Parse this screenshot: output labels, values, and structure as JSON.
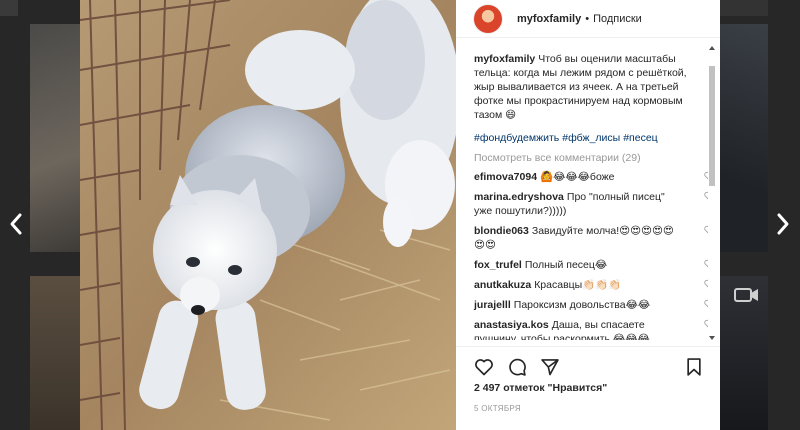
{
  "post": {
    "username": "myfoxfamily",
    "separator": "•",
    "follow_label": "Подписки",
    "caption_user": "myfoxfamily",
    "caption_text": "Чтоб вы оценили масштабы тельца: когда мы лежим рядом с решёткой, жыр вываливается из ячеек. А на третьей фотке мы прокрастинируем над кормовым тазом 😄",
    "hashtags": [
      "#фондбудемжить",
      "#фбж_лисы",
      "#песец"
    ],
    "view_all_comments": "Посмотреть все комментарии (29)",
    "likes": "2 497 отметок \"Нравится\"",
    "date": "5 октября"
  },
  "comments": [
    {
      "user": "efimova7094",
      "text": "🙆😂😂😂боже"
    },
    {
      "user": "marina.edryshova",
      "text": "Про \"полный писец\" уже пошутили?)))))"
    },
    {
      "user": "blondie063",
      "text": "Завидуйте молча!😍😍😍😍😍😍😍"
    },
    {
      "user": "fox_trufel",
      "text": "Полный песец😂"
    },
    {
      "user": "anutkakuza",
      "text": "Красавцы👏🏻👏🏻👏🏻"
    },
    {
      "user": "jurajelll",
      "text": "Пароксизм довольства😂😂"
    },
    {
      "user": "anastasiya.kos",
      "text": "Даша, вы спасаете пушнину, чтобы раскормить 😂😂😂"
    }
  ],
  "icons": {
    "prev": "chevron-left-icon",
    "next": "chevron-right-icon",
    "photo_next": "chevron-right-icon",
    "like": "heart-icon",
    "comment": "comment-bubble-icon",
    "share": "paper-plane-icon",
    "save": "bookmark-icon",
    "comment_like": "heart-icon",
    "video": "video-camera-icon"
  },
  "colors": {
    "overlay": "#272727",
    "panel": "#ffffff",
    "hashtag": "#003569",
    "muted": "#999999"
  }
}
